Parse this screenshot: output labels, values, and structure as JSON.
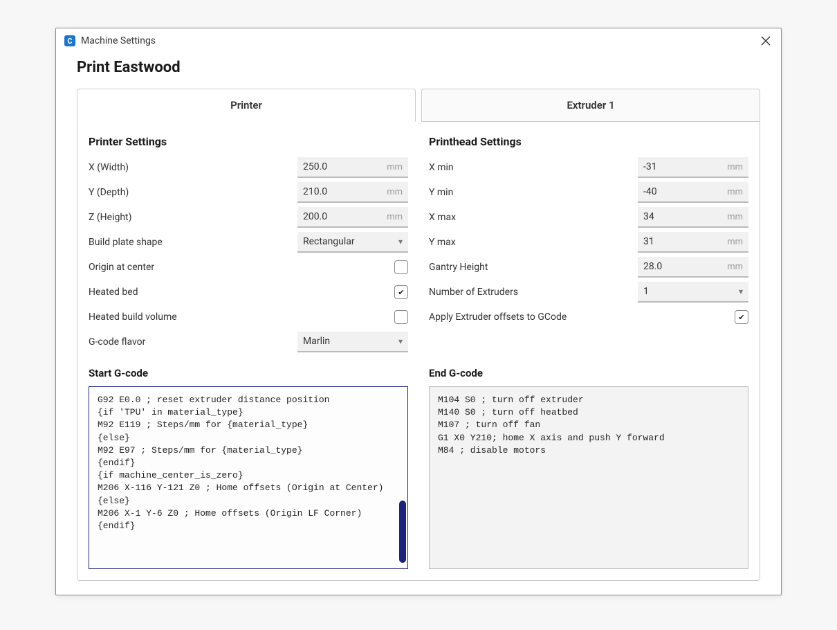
{
  "window": {
    "title": "Machine Settings",
    "app_icon_letter": "C"
  },
  "page_title": "Print Eastwood",
  "tabs": [
    {
      "label": "Printer",
      "active": true
    },
    {
      "label": "Extruder 1",
      "active": false
    }
  ],
  "printer_settings": {
    "section_title": "Printer Settings",
    "fields": {
      "x_width": {
        "label": "X (Width)",
        "value": "250.0",
        "unit": "mm"
      },
      "y_depth": {
        "label": "Y (Depth)",
        "value": "210.0",
        "unit": "mm"
      },
      "z_height": {
        "label": "Z (Height)",
        "value": "200.0",
        "unit": "mm"
      },
      "build_plate_shape": {
        "label": "Build plate shape",
        "value": "Rectangular"
      },
      "origin_at_center": {
        "label": "Origin at center",
        "checked": false
      },
      "heated_bed": {
        "label": "Heated bed",
        "checked": true
      },
      "heated_build_volume": {
        "label": "Heated build volume",
        "checked": false
      },
      "gcode_flavor": {
        "label": "G-code flavor",
        "value": "Marlin"
      }
    }
  },
  "printhead_settings": {
    "section_title": "Printhead Settings",
    "fields": {
      "x_min": {
        "label": "X min",
        "value": "-31",
        "unit": "mm"
      },
      "y_min": {
        "label": "Y min",
        "value": "-40",
        "unit": "mm"
      },
      "x_max": {
        "label": "X max",
        "value": "34",
        "unit": "mm"
      },
      "y_max": {
        "label": "Y max",
        "value": "31",
        "unit": "mm"
      },
      "gantry_height": {
        "label": "Gantry Height",
        "value": "28.0",
        "unit": "mm"
      },
      "num_extruders": {
        "label": "Number of Extruders",
        "value": "1"
      },
      "apply_offsets": {
        "label": "Apply Extruder offsets to GCode",
        "checked": true
      }
    }
  },
  "start_gcode": {
    "title": "Start G-code",
    "content": "G92 E0.0 ; reset extruder distance position\n{if 'TPU' in material_type}\nM92 E119 ; Steps/mm for {material_type}\n{else}\nM92 E97 ; Steps/mm for {material_type}\n{endif}\n{if machine_center_is_zero}\nM206 X-116 Y-121 Z0 ; Home offsets (Origin at Center)\n{else}\nM206 X-1 Y-6 Z0 ; Home offsets (Origin LF Corner)\n{endif}"
  },
  "end_gcode": {
    "title": "End G-code",
    "content": "M104 S0 ; turn off extruder\nM140 S0 ; turn off heatbed\nM107 ; turn off fan\nG1 X0 Y210; home X axis and push Y forward\nM84 ; disable motors"
  }
}
